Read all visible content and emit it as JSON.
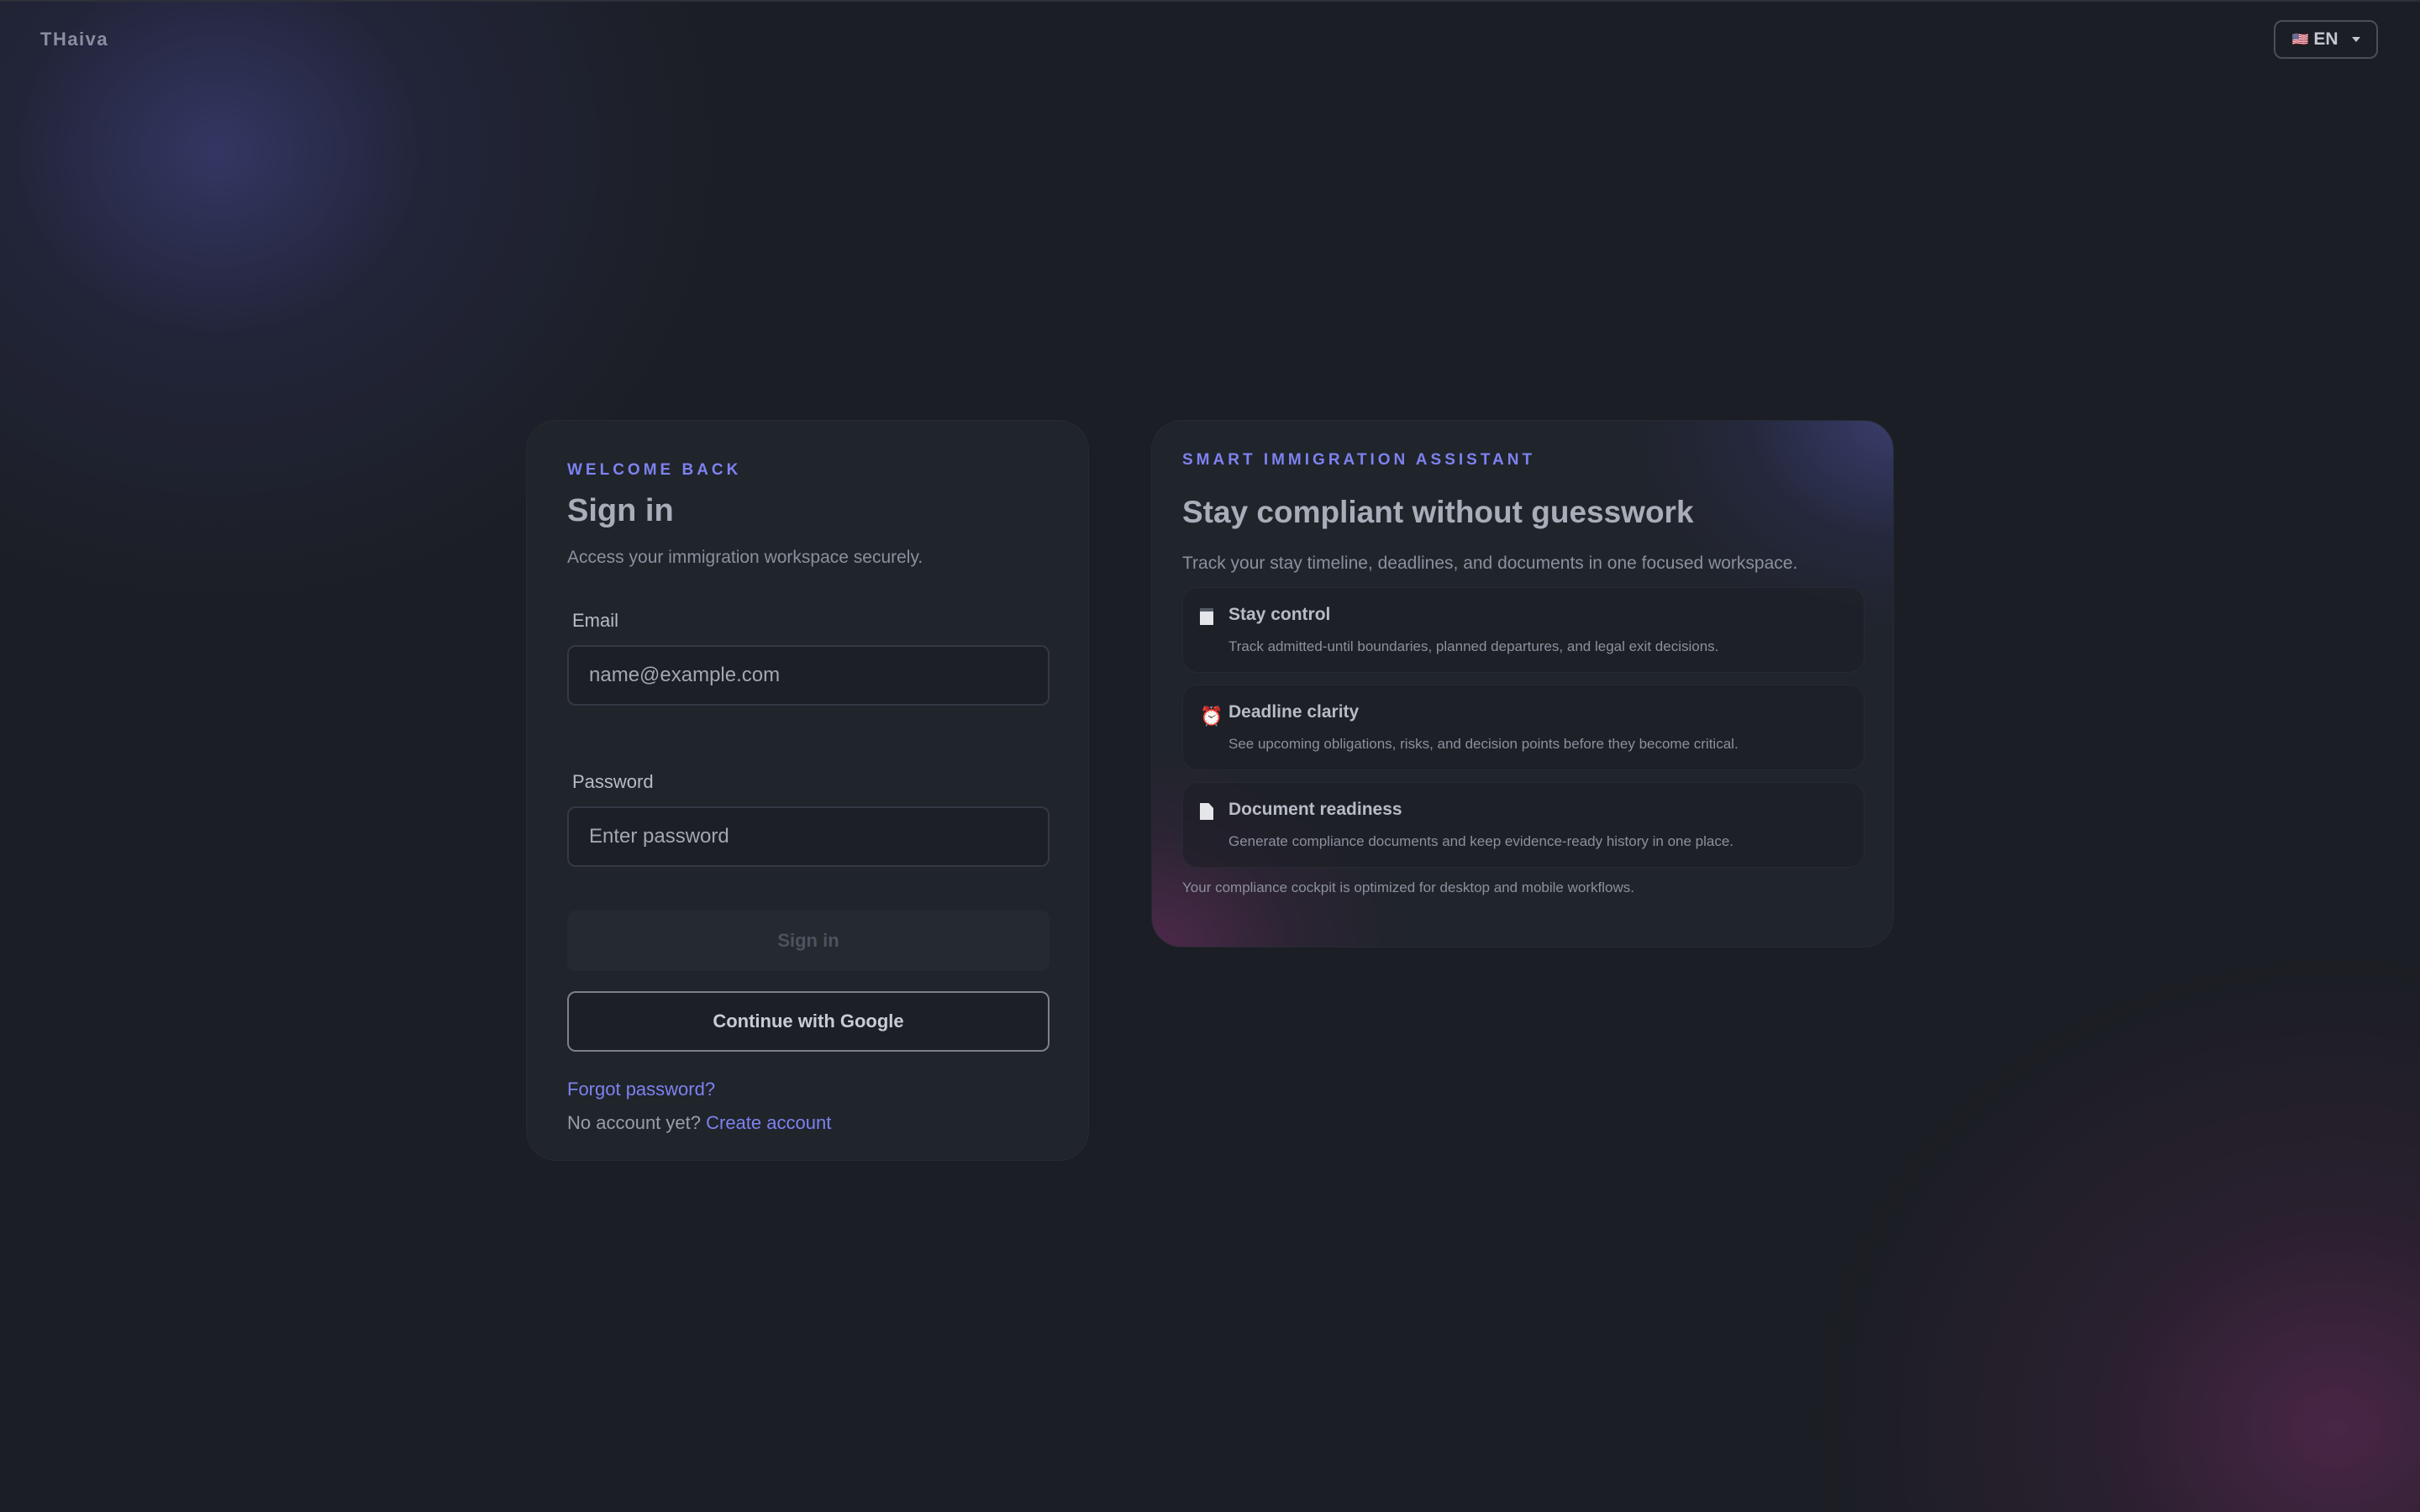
{
  "brand": "THaiva",
  "language": {
    "flag": "🇺🇸",
    "label": "EN"
  },
  "signin": {
    "eyebrow": "WELCOME BACK",
    "title": "Sign in",
    "subtitle": "Access your immigration workspace securely.",
    "email_label": "Email",
    "email_placeholder": "name@example.com",
    "password_label": "Password",
    "password_placeholder": "Enter password",
    "signin_button": "Sign in",
    "google_button": "Continue with Google",
    "forgot_link": "Forgot password?",
    "no_account_text": "No account yet?",
    "create_account_link": "Create account"
  },
  "assistant": {
    "eyebrow": "SMART IMMIGRATION ASSISTANT",
    "title": "Stay compliant without guesswork",
    "lead": "Track your stay timeline, deadlines, and documents in one focused workspace.",
    "features": [
      {
        "icon": "note-icon",
        "title": "Stay control",
        "desc": "Track admitted-until boundaries, planned departures, and legal exit decisions."
      },
      {
        "icon": "alarm-clock-icon",
        "icon_glyph": "⏰",
        "title": "Deadline clarity",
        "desc": "See upcoming obligations, risks, and decision points before they become critical."
      },
      {
        "icon": "document-icon",
        "title": "Document readiness",
        "desc": "Generate compliance documents and keep evidence-ready history in one place."
      }
    ],
    "footnote": "Your compliance cockpit is optimized for desktop and mobile workflows."
  }
}
